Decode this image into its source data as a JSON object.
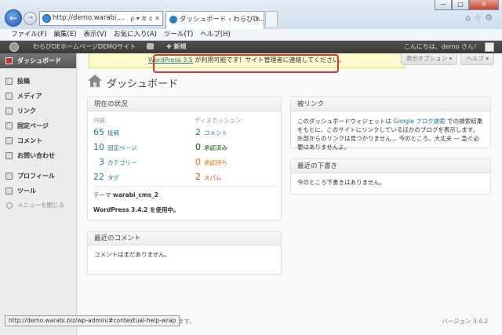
{
  "browser": {
    "address": "http://demo.warabi....",
    "tab_title": "ダッシュボード ‹ わらびD...",
    "window_buttons": [
      "—",
      "□",
      "✕"
    ],
    "addr_tools": "ρ ▾ ≣ ¢ ✕",
    "tab_close": "×",
    "right_icons": "⌂☆⚙",
    "status_url": "http://demo.warabi.biz/wp-admin/#contextual-help-wrap"
  },
  "menubar": [
    "ファイル(F)",
    "編集(E)",
    "表示(V)",
    "お気に入り(A)",
    "ツール(T)",
    "ヘルプ(H)"
  ],
  "adminbar": {
    "site_name": "わらびDEホームページDEMOサイト",
    "new_label": "✚ 新規",
    "greeting": "こんにちは、demo さん！"
  },
  "sidebar": {
    "items": [
      {
        "label": "ダッシュボード",
        "icon": "home-icon"
      },
      {
        "label": "投稿",
        "icon": "pin-icon"
      },
      {
        "label": "メディア",
        "icon": "media-icon"
      },
      {
        "label": "リンク",
        "icon": "link-icon"
      },
      {
        "label": "固定ページ",
        "icon": "page-icon"
      },
      {
        "label": "コメント",
        "icon": "comment-icon"
      },
      {
        "label": "お問い合わせ",
        "icon": "contact-icon"
      },
      {
        "label": "プロフィール",
        "icon": "user-icon"
      },
      {
        "label": "ツール",
        "icon": "tools-icon"
      }
    ],
    "collapse_label": "メニューを閉じる"
  },
  "notice": {
    "link_text": "WordPress 3.5",
    "rest_text": " が利用可能です！サイト管理者に連絡してください。"
  },
  "screen_tabs": {
    "options": "表示オプション ▾",
    "help": "ヘルプ ▾"
  },
  "page_title": "ダッシュボード",
  "right_now": {
    "title": "現在の状況",
    "content_head": "内容",
    "discussion_head": "ディスカッション",
    "content": [
      {
        "num": "65",
        "label": "投稿"
      },
      {
        "num": "10",
        "label": "固定ページ"
      },
      {
        "num": "3",
        "label": "カテゴリー"
      },
      {
        "num": "22",
        "label": "タグ"
      }
    ],
    "discussion": [
      {
        "num": "2",
        "label": "コメント"
      },
      {
        "num": "0",
        "label": "承認済み"
      },
      {
        "num": "0",
        "label": "承認待ち"
      },
      {
        "num": "2",
        "label": "スパム"
      }
    ],
    "theme_prefix": "テーマ ",
    "theme_name": "warabi_cms_2",
    "wp_version_line": "WordPress 3.4.2 を使用中。"
  },
  "recent_comments": {
    "title": "最近のコメント",
    "body": "コメントはまだありません。"
  },
  "incoming_links": {
    "title": "被リンク",
    "body_before": "このダッシュボードウィジェットは ",
    "body_link": "Google ブログ検索",
    "body_after": " での検索結果をもとに、このサイトにリンクしているほかのブログを表示します。外部からのリンクは見つかりません… 今のところ。大丈夫 — 急ぐ必要はありませんよ。"
  },
  "recent_drafts": {
    "title": "最近の下書き",
    "body": "今のところ下書きはありません。"
  },
  "footer": {
    "left_fragment": "ます。",
    "version": "バージョン 3.4.2"
  }
}
